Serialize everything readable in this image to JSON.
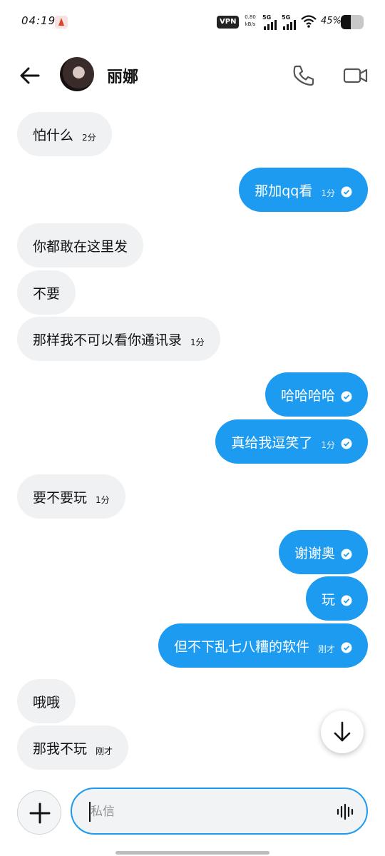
{
  "status_bar": {
    "time": "04:19",
    "vpn": "VPN",
    "net_speed": "0.80",
    "net_speed_unit": "kB/s",
    "signal_1": "5G",
    "signal_2": "5G",
    "battery_text": "45%",
    "battery_level": 0.45
  },
  "header": {
    "contact_name": "丽娜",
    "back_icon": "arrow-left-icon",
    "call_icon": "phone-icon",
    "video_icon": "video-camera-icon"
  },
  "messages": [
    {
      "dir": "in",
      "text": "怕什么",
      "time": "2分"
    },
    {
      "dir": "out",
      "text": "那加qq看",
      "time": "1分",
      "read": true
    },
    {
      "dir": "in",
      "text": "你都敢在这里发",
      "time": ""
    },
    {
      "dir": "in",
      "text": "不要",
      "time": ""
    },
    {
      "dir": "in",
      "text": "那样我不可以看你通讯录",
      "time": "1分"
    },
    {
      "dir": "out",
      "text": "哈哈哈哈",
      "time": "",
      "read": true
    },
    {
      "dir": "out",
      "text": "真给我逗笑了",
      "time": "1分",
      "read": true
    },
    {
      "dir": "in",
      "text": "要不要玩",
      "time": "1分"
    },
    {
      "dir": "out",
      "text": "谢谢奥",
      "time": "",
      "read": true
    },
    {
      "dir": "out",
      "text": "玩",
      "time": "",
      "read": true
    },
    {
      "dir": "out",
      "text": "但不下乱七八糟的软件",
      "time": "刚才",
      "read": true
    },
    {
      "dir": "in",
      "text": "哦哦",
      "time": ""
    },
    {
      "dir": "in",
      "text": "那我不玩",
      "time": "刚才"
    }
  ],
  "composer": {
    "placeholder": "私信",
    "value": ""
  },
  "colors": {
    "outgoing_bubble": "#1d9bf0",
    "incoming_bubble": "#eff1f3",
    "input_border": "#1d9bf0"
  }
}
